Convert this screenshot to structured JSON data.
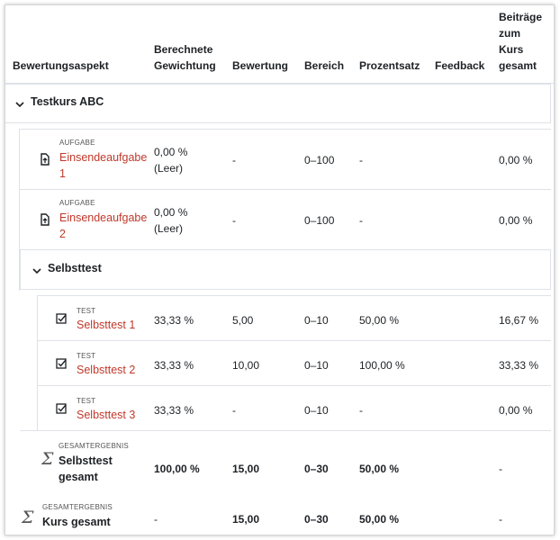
{
  "header": {
    "aspect": "Bewertungsaspekt",
    "weight": "Berechnete Gewichtung",
    "grade": "Bewertung",
    "range": "Bereich",
    "percent": "Prozentsatz",
    "feedback": "Feedback",
    "contribution": "Beiträge zum Kurs gesamt"
  },
  "course_category": {
    "title": "Testkurs ABC"
  },
  "assignments": [
    {
      "type": "AUFGABE",
      "name": "Einsendeaufgabe 1",
      "weight": "0,00 %",
      "weight_note": "(Leer)",
      "grade": "-",
      "range": "0–100",
      "percent": "-",
      "contribution": "0,00 %"
    },
    {
      "type": "AUFGABE",
      "name": "Einsendeaufgabe 2",
      "weight": "0,00 %",
      "weight_note": "(Leer)",
      "grade": "-",
      "range": "0–100",
      "percent": "-",
      "contribution": "0,00 %"
    }
  ],
  "sub_category": {
    "title": "Selbsttest"
  },
  "tests": [
    {
      "type": "TEST",
      "name": "Selbsttest 1",
      "weight": "33,33 %",
      "grade": "5,00",
      "range": "0–10",
      "percent": "50,00 %",
      "contribution": "16,67 %"
    },
    {
      "type": "TEST",
      "name": "Selbsttest 2",
      "weight": "33,33 %",
      "grade": "10,00",
      "range": "0–10",
      "percent": "100,00 %",
      "contribution": "33,33 %"
    },
    {
      "type": "TEST",
      "name": "Selbsttest 3",
      "weight": "33,33 %",
      "grade": "-",
      "range": "0–10",
      "percent": "-",
      "contribution": "0,00 %"
    }
  ],
  "sub_total": {
    "type": "GESAMTERGEBNIS",
    "name": "Selbsttest gesamt",
    "weight": "100,00 %",
    "grade": "15,00",
    "range": "0–30",
    "percent": "50,00 %",
    "contribution": "-"
  },
  "course_total": {
    "type": "GESAMTERGEBNIS",
    "name": "Kurs gesamt",
    "weight": "-",
    "grade": "15,00",
    "range": "0–30",
    "percent": "50,00 %",
    "contribution": "-"
  },
  "icons": {
    "assign": "assignment-icon",
    "quiz": "quiz-icon",
    "sigma": "sigma-icon",
    "chevron": "chevron-down-icon"
  }
}
